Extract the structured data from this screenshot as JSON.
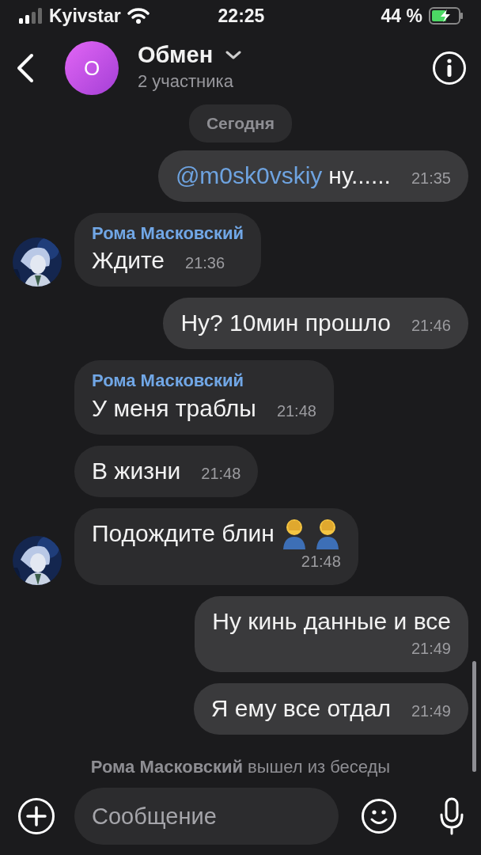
{
  "status_bar": {
    "carrier": "Kyivstar",
    "time": "22:25",
    "battery": "44 %"
  },
  "header": {
    "avatar_letter": "О",
    "title": "Обмен",
    "subtitle": "2 участника"
  },
  "date_badge": "Сегодня",
  "messages": [
    {
      "kind": "outgoing",
      "mention": "@m0sk0vskiy",
      "text": "ну......",
      "time": "21:35",
      "time_below": false
    },
    {
      "kind": "incoming",
      "sender": "Рома Масковский",
      "text": "Ждите",
      "time": "21:36",
      "time_below": false,
      "avatar": true
    },
    {
      "kind": "outgoing",
      "text": "Ну? 10мин прошло",
      "time": "21:46",
      "time_below": false
    },
    {
      "kind": "incoming",
      "sender": "Рома Масковский",
      "text": "У меня траблы",
      "time": "21:48",
      "time_below": false,
      "avatar": false
    },
    {
      "kind": "incoming",
      "text": "В жизни",
      "time": "21:48",
      "time_below": false,
      "avatar": false
    },
    {
      "kind": "incoming",
      "text": "Подождите блин",
      "emojis": [
        {
          "kind": "facepalm"
        },
        {
          "kind": "facepalm"
        }
      ],
      "time": "21:48",
      "time_below": true,
      "avatar": true
    },
    {
      "kind": "outgoing",
      "text": "Ну кинь данные и все",
      "time": "21:49",
      "time_below": true
    },
    {
      "kind": "outgoing",
      "text": "Я ему все отдал",
      "time": "21:49",
      "time_below": false
    }
  ],
  "system_message": "**Рома Масковский** вышел из беседы",
  "composer": {
    "placeholder": "Сообщение"
  }
}
